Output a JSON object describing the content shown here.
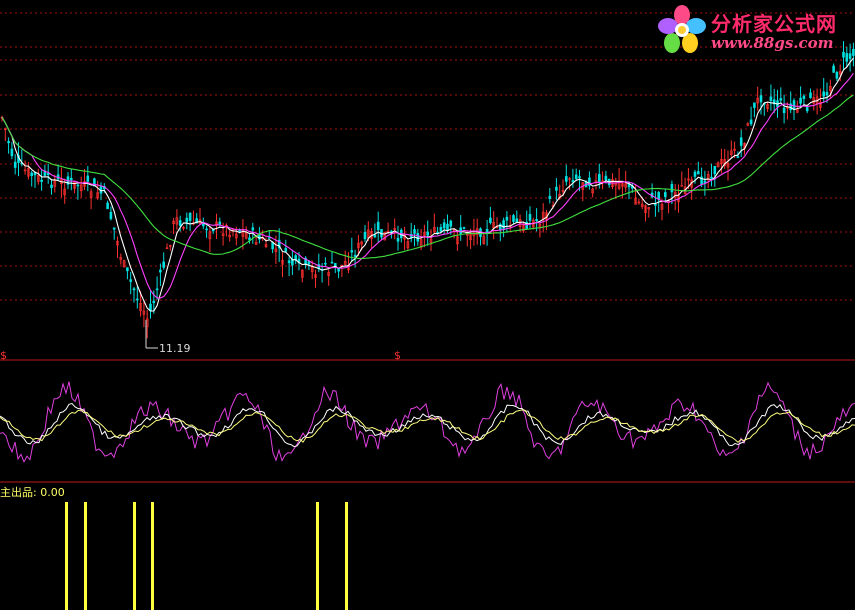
{
  "logo": {
    "title": "分析家公式网",
    "url": "www.88gs.com"
  },
  "chart_data": [
    {
      "type": "candlestick",
      "panel": "price",
      "annotations": [
        "11.19"
      ],
      "low_point": 11.19,
      "series": [
        {
          "name": "",
          "color": "#ffffff",
          "values": []
        },
        {
          "name": "",
          "color": "#ff40ff",
          "values": []
        },
        {
          "name": "",
          "color": "#40e040",
          "values": []
        }
      ],
      "colors": {
        "up": "#ff3030",
        "down": "#00e0e0",
        "grid": "#a01010"
      },
      "grid": true
    },
    {
      "type": "line",
      "panel": "oscillator",
      "series": [
        {
          "name": "",
          "color": "#e040e0"
        },
        {
          "name": "",
          "color": "#ffffff"
        },
        {
          "name": "",
          "color": "#ffff80"
        }
      ],
      "markers": [
        "$",
        "$"
      ]
    },
    {
      "type": "bar",
      "panel": "signal",
      "label": "主出品: 0.00",
      "bar_color": "#ffff40",
      "signal_bar_count": 6
    }
  ]
}
